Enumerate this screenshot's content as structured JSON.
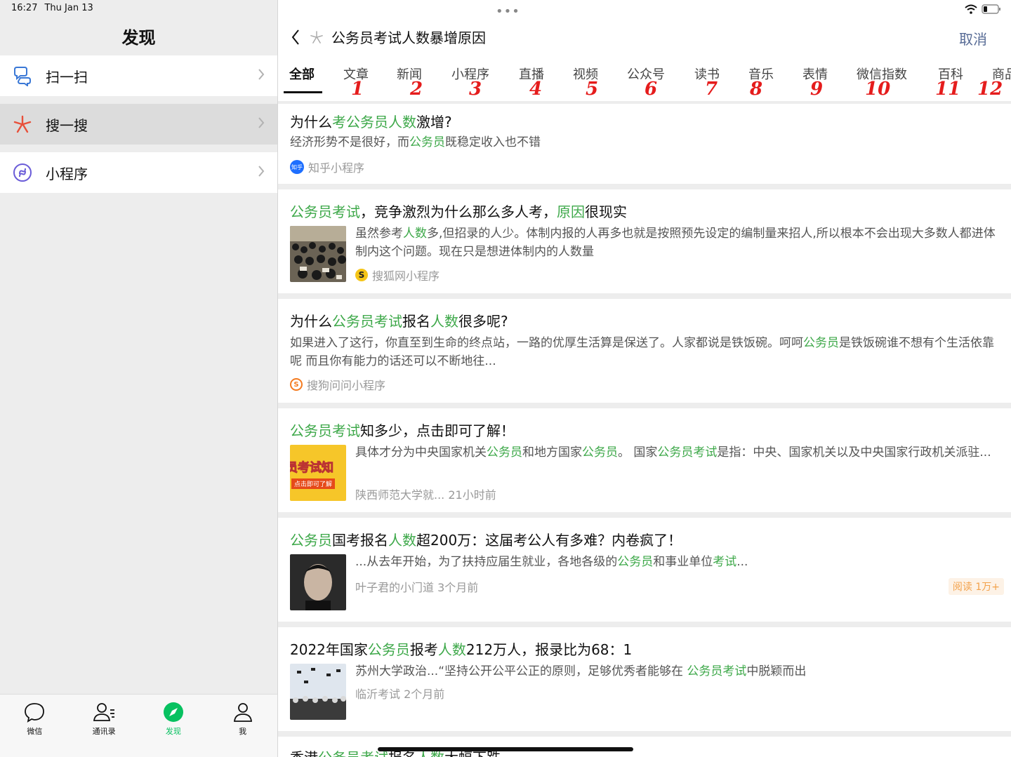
{
  "status": {
    "time": "16:27",
    "date": "Thu Jan 13"
  },
  "left": {
    "title": "发现",
    "items": [
      {
        "label": "扫一扫",
        "icon": "scan-icon"
      },
      {
        "label": "搜一搜",
        "icon": "search-sparkle-icon"
      },
      {
        "label": "小程序",
        "icon": "mini-program-icon"
      }
    ]
  },
  "tabbar": [
    {
      "label": "微信",
      "icon": "chat-icon"
    },
    {
      "label": "通讯录",
      "icon": "contacts-icon"
    },
    {
      "label": "发现",
      "icon": "compass-icon"
    },
    {
      "label": "我",
      "icon": "profile-icon"
    }
  ],
  "search": {
    "query": "公务员考试人数暴增原因",
    "cancel": "取消"
  },
  "tabs": [
    "全部",
    "文章",
    "新闻",
    "小程序",
    "直播",
    "视频",
    "公众号",
    "读书",
    "音乐",
    "表情",
    "微信指数",
    "百科",
    "商品"
  ],
  "annotations": [
    "1",
    "2",
    "3",
    "4",
    "5",
    "6",
    "7",
    "8",
    "9",
    "10",
    "11",
    "12"
  ],
  "results": [
    {
      "title_pre": "为什么",
      "title_hl1": "考公务员人数",
      "title_post": "激增?",
      "desc_pre": "经济形势不是很好，而",
      "desc_hl": "公务员",
      "desc_post": "既稳定收入也不错",
      "source": "知乎小程序",
      "source_icon_text": "知乎"
    },
    {
      "title_hl1": "公务员考试",
      "title_mid": "，竞争激烈为什么那么多人考，",
      "title_hl2": "原因",
      "title_post": "很现实",
      "desc_pre": "虽然参考",
      "desc_hl": "人数",
      "desc_post": "多,但招录的人少。体制内报的人再多也就是按照预先设定的编制量来招人,所以根本不会出现大多数人都进体制内这个问题。现在只是想进体制内的人数量",
      "source": "搜狐网小程序"
    },
    {
      "title_pre": "为什么",
      "title_hl1": "公务员考试",
      "title_mid": "报名",
      "title_hl2": "人数",
      "title_post": "很多呢?",
      "desc_pre": "如果进入了这行，你直至到生命的终点站，一路的优厚生活算是保送了。人家都说是铁饭碗。呵呵",
      "desc_hl": "公务员",
      "desc_post": "是铁饭碗谁不想有个生活依靠呢 而且你有能力的话还可以不断地往...",
      "source": "搜狗问问小程序"
    },
    {
      "title_hl1": "公务员考试",
      "title_post": "知多少，点击即可了解！",
      "desc_pre": "具体才分为中央国家机关",
      "desc_hl": "公务员",
      "desc_mid": "和地方国家",
      "desc_hl2": "公务员",
      "desc_mid2": "。 国家",
      "desc_hl3": "公务员考试",
      "desc_post": "是指：中央、国家机关以及中央国家行政机关派驻...",
      "source": "陕西师范大学就...  21小时前",
      "thumb_text": "员考试知",
      "thumb_btn": "点击即可了解"
    },
    {
      "title_hl1": "公务员",
      "title_mid": "国考报名",
      "title_hl2": "人数",
      "title_post": "超200万：这届考公人有多难？内卷疯了！",
      "desc_pre": "...从去年开始，为了扶持应届生就业，各地各级的",
      "desc_hl": "公务员",
      "desc_mid": "和事业单位",
      "desc_hl2": "考试",
      "desc_post": "...",
      "source": "叶子君的小门道  3个月前",
      "badge": "阅读 1万+"
    },
    {
      "title_pre": "2022年国家",
      "title_hl1": "公务员",
      "title_mid": "报考",
      "title_hl2": "人数",
      "title_post": "212万人，报录比为68：1",
      "desc_pre": "苏州大学政治...“坚持公开公平公正的原则，足够优秀者能够在 ",
      "desc_hl": "公务员考试",
      "desc_post": "中脱颖而出",
      "source": "临沂考试  2个月前"
    },
    {
      "title_pre": "香港",
      "title_hl1": "公务员考试",
      "title_mid": "报名",
      "title_hl2": "人数",
      "title_post": "大幅下跌"
    }
  ]
}
